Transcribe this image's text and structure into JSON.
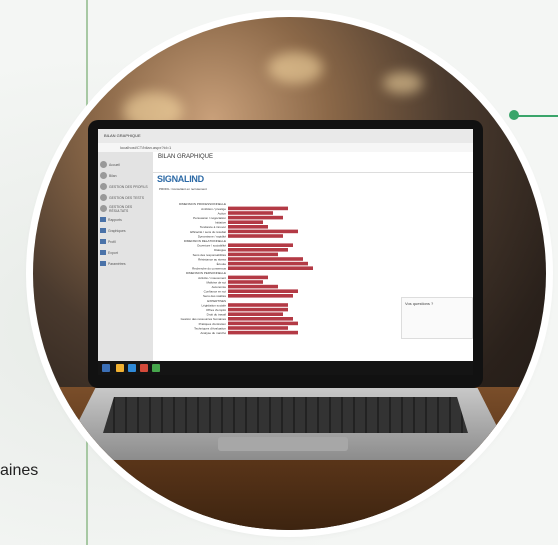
{
  "left_text": "aines",
  "browser": {
    "tab_title": "BILAN GRAPHIQUE",
    "url": "localhost/CT/bilan.aspx?id=1"
  },
  "app": {
    "page_title": "BILAN GRAPHIQUE",
    "logo": "SIGNALIND",
    "sidebar": [
      {
        "label": "Accueil"
      },
      {
        "label": "Bilan"
      },
      {
        "label": "GESTION DES PROFILS"
      },
      {
        "label": "GESTION DES TESTS"
      },
      {
        "label": "GESTION DES RÉSULTATS"
      },
      {
        "label": "Rapports"
      },
      {
        "label": "Graphiques"
      },
      {
        "label": "Profil"
      },
      {
        "label": "Export"
      },
      {
        "label": "Paramètres"
      }
    ],
    "chart_header": "PROFIL: Consultant en recrutement",
    "right_panel_label": "Vos questions ?"
  },
  "chart_data": {
    "type": "bar",
    "categories": [
      "DIMENSION PROFESSIONNELLE",
      "Ambition / prestige",
      "Action",
      "Persuasion / négociation",
      "Initiative",
      "Tendance à innover",
      "Efficacité / sens du résultat",
      "Dynamisme / rapidité",
      "DIMENSION RELATIONNELLE",
      "Ouverture / sociabilité",
      "Dialogue",
      "Sens des responsabilités",
      "Résistance au stress",
      "Écoute",
      "Recherche du consensus",
      "DIMENSION PERSONNELLE",
      "Activité / mouvement",
      "Maîtrise de soi",
      "Autonomie",
      "Confiance en soi",
      "Sens des réalités",
      "EXPERTISES",
      "Législation sociale",
      "Offres d'emploi",
      "Droit du travail",
      "Gestion des ressources humaines",
      "Pratiques d'entretien",
      "Techniques d'évaluation",
      "Analyse du marché"
    ],
    "values": [
      0,
      60,
      45,
      55,
      35,
      40,
      70,
      55,
      0,
      65,
      60,
      50,
      75,
      80,
      85,
      0,
      40,
      35,
      50,
      70,
      65,
      0,
      60,
      60,
      55,
      65,
      70,
      60,
      70
    ],
    "colors": {
      "bar": "#b33a45",
      "accent": "#5a9e4a",
      "orange": "#e08a2a"
    }
  }
}
